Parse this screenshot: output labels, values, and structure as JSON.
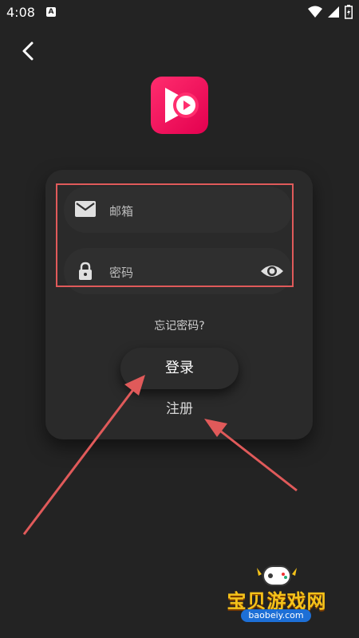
{
  "status_bar": {
    "time": "4:08",
    "notification_letter": "A"
  },
  "form": {
    "email_placeholder": "邮箱",
    "password_placeholder": "密码",
    "forgot_password": "忘记密码?",
    "login_label": "登录",
    "register_label": "注册"
  },
  "watermark": {
    "text": "宝贝游戏网",
    "url": "baobeiy.com"
  },
  "colors": {
    "background": "#232323",
    "brand": "#ff2d6e",
    "highlight": "#e05a5a",
    "arrow": "#e05a5a"
  }
}
